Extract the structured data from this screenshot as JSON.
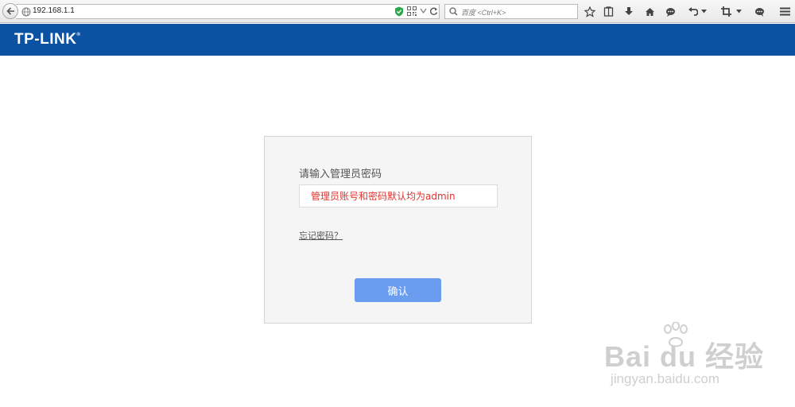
{
  "browser": {
    "url": "192.168.1.1",
    "search_placeholder": "百度 <Ctrl+K>",
    "icons": [
      "back-arrow-icon",
      "globe-icon",
      "shield-icon",
      "qr-code-icon",
      "dropdown-icon",
      "reload-icon",
      "search-icon",
      "star-icon",
      "reading-list-icon",
      "download-icon",
      "home-icon",
      "chat-icon",
      "undo-icon",
      "crop-icon",
      "bubble-icon",
      "menu-icon"
    ]
  },
  "header": {
    "logo": "TP-LINK",
    "logo_mark": "®",
    "bg_color": "#0b52a3"
  },
  "login": {
    "prompt": "请输入管理员密码",
    "password_placeholder": "管理员账号和密码默认均为admin",
    "forgot_link": "忘记密码？",
    "confirm_button": "确认",
    "accent_color": "#6a9cf0",
    "placeholder_color": "#e0342d"
  },
  "watermark": {
    "text": "Bai du 经验",
    "url": "jingyan.baidu.com"
  }
}
